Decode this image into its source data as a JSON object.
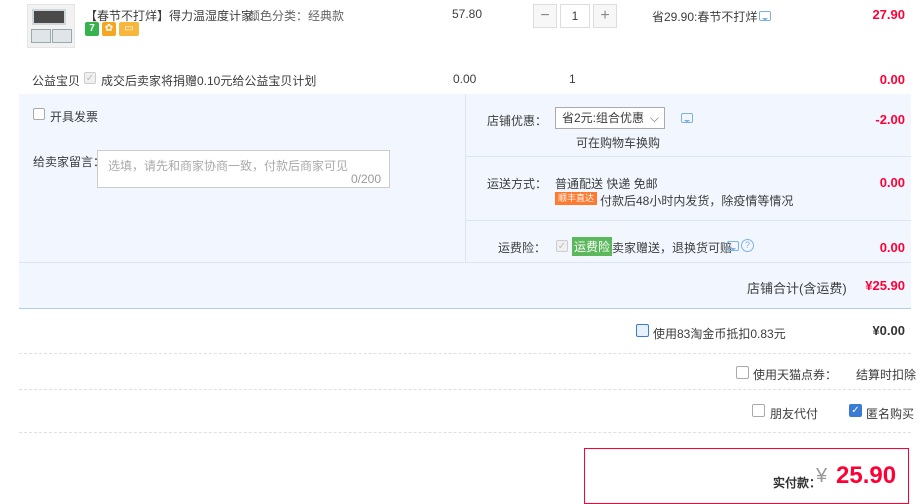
{
  "item": {
    "title": "【春节不打烊】得力温湿度计家...",
    "sku": "颜色分类：经典款",
    "unit_price": "57.80",
    "quantity": "1",
    "minus": "−",
    "plus": "+",
    "discount_note": "省29.90:春节不打烊",
    "subtotal": "27.90",
    "badge_seven": "7",
    "badges": [
      "seven-day-return-icon",
      "guarantee-icon",
      "card-icon"
    ]
  },
  "charity": {
    "label": "公益宝贝",
    "text": "成交后卖家将捐赠0.10元给公益宝贝计划",
    "price": "0.00",
    "quantity": "1",
    "subtotal": "0.00"
  },
  "invoice": {
    "label": "开具发票"
  },
  "message": {
    "label": "给卖家留言：",
    "placeholder": "选填，请先和商家协商一致，付款后商家可见",
    "counter": "0/200"
  },
  "shop_discount": {
    "label": "店铺优惠：",
    "selected": "省2元:组合优惠",
    "note": "可在购物车换购",
    "amount": "-2.00"
  },
  "shipping": {
    "label": "运送方式：",
    "method": "普通配送 快递 免邮",
    "tag": "顺丰直达",
    "desc": "付款后48小时内发货，除疫情等情况",
    "amount": "0.00"
  },
  "insurance": {
    "label": "运费险：",
    "tag": "运费险",
    "desc": "卖家赠送，退换货可赔",
    "amount": "0.00"
  },
  "shop_total": {
    "label": "店铺合计(含运费)",
    "amount": "¥25.90"
  },
  "coins": {
    "label": "使用83淘金币抵扣0.83元",
    "amount": "¥0.00"
  },
  "tmall_points": {
    "label": "使用天猫点券：",
    "note": "结算时扣除"
  },
  "options": {
    "friend_pay": "朋友代付",
    "anonymous": "匿名购买"
  },
  "final": {
    "label": "实付款：",
    "currency": "¥",
    "amount": "25.90"
  },
  "colors": {
    "accent_red": "#ff0036",
    "panel_bg": "#f2f7ff",
    "shipping_tag": "#ff7a2f",
    "insurance_tag": "#5cb85c"
  }
}
